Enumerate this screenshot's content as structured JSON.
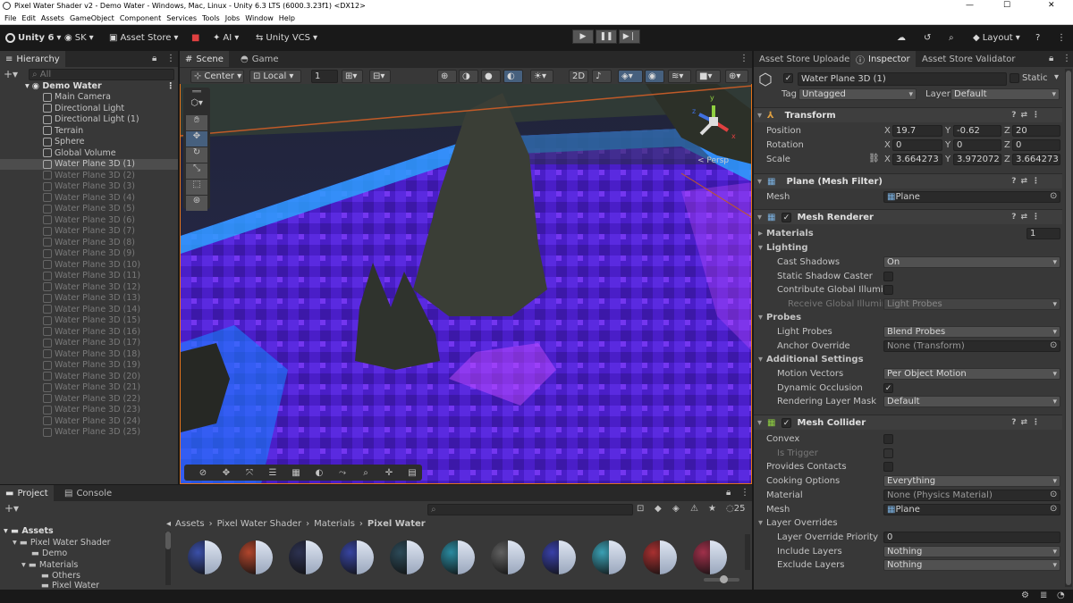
{
  "window": {
    "title": "Pixel Water Shader v2 - Demo Water - Windows, Mac, Linux - Unity 6.3 LTS (6000.3.23f1) <DX12>",
    "minimize": "—",
    "maximize": "☐",
    "close": "✕"
  },
  "menu": [
    "File",
    "Edit",
    "Assets",
    "GameObject",
    "Component",
    "Services",
    "Tools",
    "Jobs",
    "Window",
    "Help"
  ],
  "toolbar": {
    "unity": "Unity 6",
    "account": "SK",
    "asset_store": "Asset Store",
    "ai": "AI",
    "vcs": "Unity VCS",
    "layout": "Layout"
  },
  "hierarchy": {
    "tab": "Hierarchy",
    "search_placeholder": "All",
    "scene": "Demo Water",
    "items": [
      {
        "name": "Main Camera",
        "state": "normal"
      },
      {
        "name": "Directional Light",
        "state": "normal"
      },
      {
        "name": "Directional Light (1)",
        "state": "normal"
      },
      {
        "name": "Terrain",
        "state": "normal"
      },
      {
        "name": "Sphere",
        "state": "normal"
      },
      {
        "name": "Global Volume",
        "state": "normal"
      },
      {
        "name": "Water Plane 3D (1)",
        "state": "selected"
      },
      {
        "name": "Water Plane 3D (2)",
        "state": "dim"
      },
      {
        "name": "Water Plane 3D (3)",
        "state": "dim"
      },
      {
        "name": "Water Plane 3D (4)",
        "state": "dim"
      },
      {
        "name": "Water Plane 3D (5)",
        "state": "dim"
      },
      {
        "name": "Water Plane 3D (6)",
        "state": "dim"
      },
      {
        "name": "Water Plane 3D (7)",
        "state": "dim"
      },
      {
        "name": "Water Plane 3D (8)",
        "state": "dim"
      },
      {
        "name": "Water Plane 3D (9)",
        "state": "dim"
      },
      {
        "name": "Water Plane 3D (10)",
        "state": "dim"
      },
      {
        "name": "Water Plane 3D (11)",
        "state": "dim"
      },
      {
        "name": "Water Plane 3D (12)",
        "state": "dim"
      },
      {
        "name": "Water Plane 3D (13)",
        "state": "dim"
      },
      {
        "name": "Water Plane 3D (14)",
        "state": "dim"
      },
      {
        "name": "Water Plane 3D (15)",
        "state": "dim"
      },
      {
        "name": "Water Plane 3D (16)",
        "state": "dim"
      },
      {
        "name": "Water Plane 3D (17)",
        "state": "dim"
      },
      {
        "name": "Water Plane 3D (18)",
        "state": "dim"
      },
      {
        "name": "Water Plane 3D (19)",
        "state": "dim"
      },
      {
        "name": "Water Plane 3D (20)",
        "state": "dim"
      },
      {
        "name": "Water Plane 3D (21)",
        "state": "dim"
      },
      {
        "name": "Water Plane 3D (22)",
        "state": "dim"
      },
      {
        "name": "Water Plane 3D (23)",
        "state": "dim"
      },
      {
        "name": "Water Plane 3D (24)",
        "state": "dim"
      },
      {
        "name": "Water Plane 3D (25)",
        "state": "dim"
      }
    ]
  },
  "scene": {
    "tab_scene": "Scene",
    "tab_game": "Game",
    "pivot": "Center",
    "space": "Local",
    "snap": "1",
    "persp": "< Persp",
    "gizmo_y": "y",
    "gizmo_x": "x",
    "gizmo_z": "z"
  },
  "inspector": {
    "tabs": [
      "Asset Store Uploader",
      "Inspector",
      "Asset Store Validator"
    ],
    "object_name": "Water Plane 3D (1)",
    "static": "Static",
    "tag_label": "Tag",
    "tag": "Untagged",
    "layer_label": "Layer",
    "layer": "Default",
    "transform": {
      "title": "Transform",
      "position_label": "Position",
      "position": [
        "19.7",
        "-0.62",
        "20"
      ],
      "rotation_label": "Rotation",
      "rotation": [
        "0",
        "0",
        "0"
      ],
      "scale_label": "Scale",
      "scale": [
        "3.664273",
        "3.972072",
        "3.664273"
      ]
    },
    "mesh_filter": {
      "title": "Plane (Mesh Filter)",
      "mesh_label": "Mesh",
      "mesh": "Plane"
    },
    "mesh_renderer": {
      "title": "Mesh Renderer",
      "materials_label": "Materials",
      "materials_count": "1",
      "lighting": "Lighting",
      "cast_shadows_label": "Cast Shadows",
      "cast_shadows": "On",
      "static_shadow_label": "Static Shadow Caster",
      "contribute_gi_label": "Contribute Global Illuminat",
      "receive_gi_label": "Receive Global Illuminati",
      "receive_gi": "Light Probes",
      "probes": "Probes",
      "light_probes_label": "Light Probes",
      "light_probes": "Blend Probes",
      "anchor_label": "Anchor Override",
      "anchor": "None (Transform)",
      "additional": "Additional Settings",
      "motion_label": "Motion Vectors",
      "motion": "Per Object Motion",
      "dyn_occ_label": "Dynamic Occlusion",
      "layer_mask_label": "Rendering Layer Mask",
      "layer_mask": "Default"
    },
    "mesh_collider": {
      "title": "Mesh Collider",
      "convex_label": "Convex",
      "trigger_label": "Is Trigger",
      "contacts_label": "Provides Contacts",
      "cooking_label": "Cooking Options",
      "cooking": "Everything",
      "material_label": "Material",
      "material": "None (Physics Material)",
      "mesh_label": "Mesh",
      "mesh": "Plane",
      "overrides": "Layer Overrides",
      "priority_label": "Layer Override Priority",
      "priority": "0",
      "include_label": "Include Layers",
      "include": "Nothing",
      "exclude_label": "Exclude Layers",
      "exclude": "Nothing"
    }
  },
  "project": {
    "tab_project": "Project",
    "tab_console": "Console",
    "breadcrumb": [
      "Assets",
      "Pixel Water Shader",
      "Materials",
      "Pixel Water"
    ],
    "hidden_count": "25",
    "tree": [
      "Assets",
      "Pixel Water Shader",
      "Demo",
      "Materials",
      "Others",
      "Pixel Water"
    ],
    "material_tints": [
      "#3a4fa8",
      "#b0452c",
      "#2c3150",
      "#3744a0",
      "#2c4a58",
      "#2a8aa0",
      "#606060",
      "#3840a8",
      "#3aa0b4",
      "#a83030",
      "#a0304a"
    ]
  }
}
